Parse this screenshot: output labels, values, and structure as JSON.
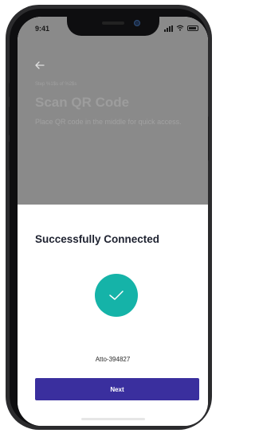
{
  "status_bar": {
    "time": "9:41"
  },
  "scan": {
    "step": "Step %1$s of %2$s",
    "title": "Scan QR Code",
    "description": "Place QR code in the middle for quick access."
  },
  "sheet": {
    "title": "Successfully Connected",
    "device_id": "Atto-394827",
    "next_label": "Next"
  },
  "colors": {
    "accent_teal": "#15b3a8",
    "button_purple": "#3a2f9e",
    "dim_overlay": "#8a8a8a"
  },
  "icons": [
    "back-arrow-icon",
    "check-icon",
    "signal-icon",
    "wifi-icon",
    "battery-icon"
  ]
}
